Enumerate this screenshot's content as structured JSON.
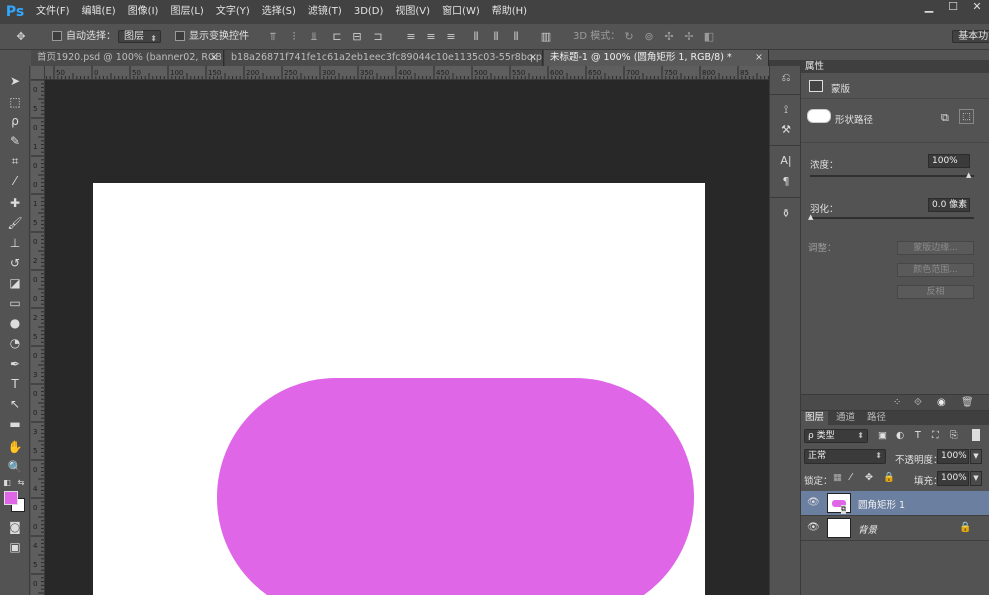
{
  "app": {
    "logo": "Ps"
  },
  "menu": [
    "文件(F)",
    "编辑(E)",
    "图像(I)",
    "图层(L)",
    "文字(Y)",
    "选择(S)",
    "滤镜(T)",
    "3D(D)",
    "视图(V)",
    "窗口(W)",
    "帮助(H)"
  ],
  "window_controls": {
    "minimize": "▁",
    "restore": "☐",
    "close": "✕"
  },
  "options": {
    "auto_select_label": "自动选择：",
    "auto_select_value": "图层",
    "show_transform_label": "显示变换控件",
    "mode_3d_label": "3D 模式：",
    "workspace_value": "基本功能"
  },
  "tabs": [
    {
      "label": "首页1920.psd @ 100% (banner02, RGB...",
      "close": "×"
    },
    {
      "label": "b18a26871f741fe1c61a2eb1eec3fc89044c10e1135c03-55r8bq.png...",
      "close": "×"
    },
    {
      "label": "未标题-1 @ 100% (圆角矩形 1, RGB/8) *",
      "close": "×"
    }
  ],
  "ruler": {
    "h_labels": [
      "50",
      "0",
      "50",
      "100",
      "150",
      "200",
      "250",
      "300",
      "350",
      "400",
      "450",
      "500",
      "550",
      "600",
      "650",
      "700",
      "750",
      "800",
      "85"
    ],
    "v_labels": [
      "0",
      "5",
      "0",
      "1",
      "0",
      "0",
      "1",
      "5",
      "0",
      "2",
      "0",
      "0",
      "2",
      "5",
      "0",
      "3",
      "0",
      "0",
      "3",
      "5",
      "0",
      "4",
      "0",
      "0",
      "4",
      "5",
      "0"
    ]
  },
  "canvas": {
    "shape_color": "#e066e8",
    "shape_name": "圆角矩形 1"
  },
  "colors": {
    "foreground": "#e066e8",
    "background": "#ffffff"
  },
  "properties": {
    "title": "属性",
    "mask_label": "蒙版",
    "shape_path_label": "形状路径",
    "density_label": "浓度：",
    "density_value": "100%",
    "feather_label": "羽化：",
    "feather_value": "0.0 像素",
    "adjust_label": "调整：",
    "mask_edge_btn": "蒙版边缘...",
    "color_range_btn": "颜色范围...",
    "invert_btn": "反相"
  },
  "layers": {
    "tabs": [
      "图层",
      "通道",
      "路径"
    ],
    "filter_kind": "ρ 类型",
    "blend_mode": "正常",
    "opacity_label": "不透明度：",
    "opacity_value": "100%",
    "lock_label": "锁定：",
    "fill_label": "填充：",
    "fill_value": "100%",
    "items": [
      {
        "name": "圆角矩形 1",
        "selected": true
      },
      {
        "name": "背景",
        "selected": false
      }
    ]
  }
}
